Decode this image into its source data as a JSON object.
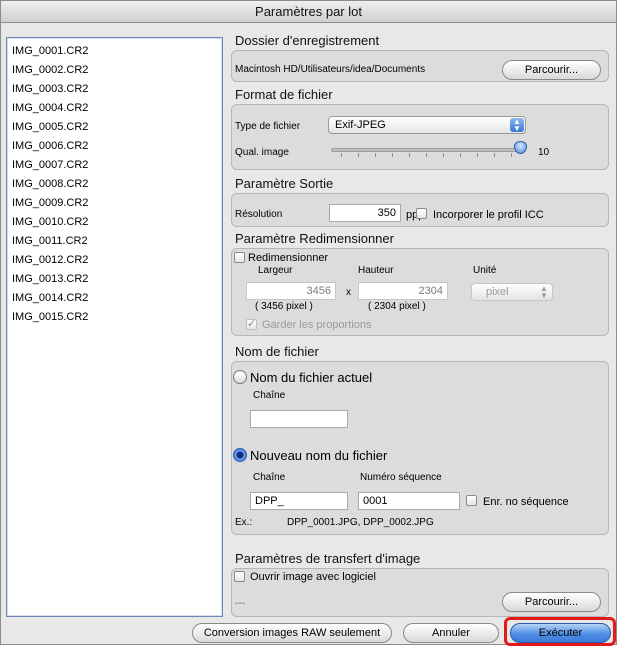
{
  "window": {
    "title": "Paramètres par lot"
  },
  "files": [
    "IMG_0001.CR2",
    "IMG_0002.CR2",
    "IMG_0003.CR2",
    "IMG_0004.CR2",
    "IMG_0005.CR2",
    "IMG_0006.CR2",
    "IMG_0007.CR2",
    "IMG_0008.CR2",
    "IMG_0009.CR2",
    "IMG_0010.CR2",
    "IMG_0011.CR2",
    "IMG_0012.CR2",
    "IMG_0013.CR2",
    "IMG_0014.CR2",
    "IMG_0015.CR2"
  ],
  "save_folder": {
    "title": "Dossier d'enregistrement",
    "path": "Macintosh HD/Utilisateurs/idea/Documents",
    "browse_label": "Parcourir..."
  },
  "file_format": {
    "title": "Format de fichier",
    "type_label": "Type de fichier",
    "type_value": "Exif-JPEG",
    "quality_label": "Qual. image",
    "quality_value": "10",
    "quality_level": 1.0
  },
  "output": {
    "title": "Paramètre Sortie",
    "resolution_label": "Résolution",
    "resolution_value": "350",
    "resolution_unit": "ppp",
    "icc_label": "Incorporer le profil ICC"
  },
  "resize": {
    "title": "Paramètre Redimensionner",
    "enable_label": "Redimensionner",
    "width_label": "Largeur",
    "height_label": "Hauteur",
    "unit_label": "Unité",
    "width_value": "3456",
    "height_value": "2304",
    "times": "x",
    "width_pixel": "( 3456 pixel )",
    "height_pixel": "( 2304 pixel )",
    "unit_value": "pixel",
    "keep_ratio_label": "Garder les  proportions"
  },
  "filename": {
    "title": "Nom de fichier",
    "current_label": "Nom du fichier actuel",
    "chain_label": "Chaîne",
    "current_chain_value": "",
    "new_label": "Nouveau nom du fichier",
    "new_chain_label": "Chaîne",
    "seq_label": "Numéro séquence",
    "new_chain_value": "DPP_",
    "seq_value": "0001",
    "save_seq_label": "Enr. no séquence",
    "example_label": "Ex.:",
    "example_value": "DPP_0001.JPG, DPP_0002.JPG"
  },
  "transfer": {
    "title": "Paramètres de transfert d'image",
    "open_label": "Ouvrir image avec logiciel",
    "app_value": "---",
    "browse_label": "Parcourir..."
  },
  "footer": {
    "raw_only_label": "Conversion images RAW seulement",
    "cancel_label": "Annuler",
    "execute_label": "Exécuter"
  }
}
